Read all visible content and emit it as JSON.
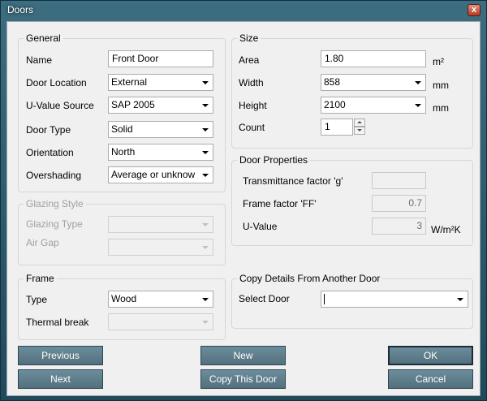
{
  "window": {
    "title": "Doors",
    "close_glyph": "x"
  },
  "general": {
    "title": "General",
    "name_label": "Name",
    "name_value": "Front Door",
    "location_label": "Door Location",
    "location_value": "External",
    "uvalue_source_label": "U-Value Source",
    "uvalue_source_value": "SAP 2005",
    "type_label": "Door Type",
    "type_value": "Solid",
    "orientation_label": "Orientation",
    "orientation_value": "North",
    "overshading_label": "Overshading",
    "overshading_value": "Average or unknow"
  },
  "glazing": {
    "title": "Glazing Style",
    "type_label": "Glazing Type",
    "type_value": "",
    "airgap_label": "Air Gap",
    "airgap_value": ""
  },
  "frame": {
    "title": "Frame",
    "type_label": "Type",
    "type_value": "Wood",
    "thermal_label": "Thermal break",
    "thermal_value": ""
  },
  "size": {
    "title": "Size",
    "area_label": "Area",
    "area_value": "1.80",
    "area_unit": "m²",
    "width_label": "Width",
    "width_value": "858",
    "width_unit": "mm",
    "height_label": "Height",
    "height_value": "2100",
    "height_unit": "mm",
    "count_label": "Count",
    "count_value": "1"
  },
  "door_props": {
    "title": "Door Properties",
    "transmittance_label": "Transmittance factor 'g'",
    "transmittance_value": "",
    "frame_factor_label": "Frame factor 'FF'",
    "frame_factor_value": "0.7",
    "uvalue_label": "U-Value",
    "uvalue_value": "3",
    "uvalue_unit": "W/m²K"
  },
  "copy": {
    "title": "Copy Details From Another Door",
    "select_label": "Select Door",
    "select_value": ""
  },
  "buttons": {
    "previous": "Previous",
    "next": "Next",
    "new": "New",
    "copy": "Copy This Door",
    "ok": "OK",
    "cancel": "Cancel"
  },
  "icons": [
    "close-icon",
    "dropdown-arrow-icon",
    "spin-up-icon",
    "spin-down-icon"
  ]
}
